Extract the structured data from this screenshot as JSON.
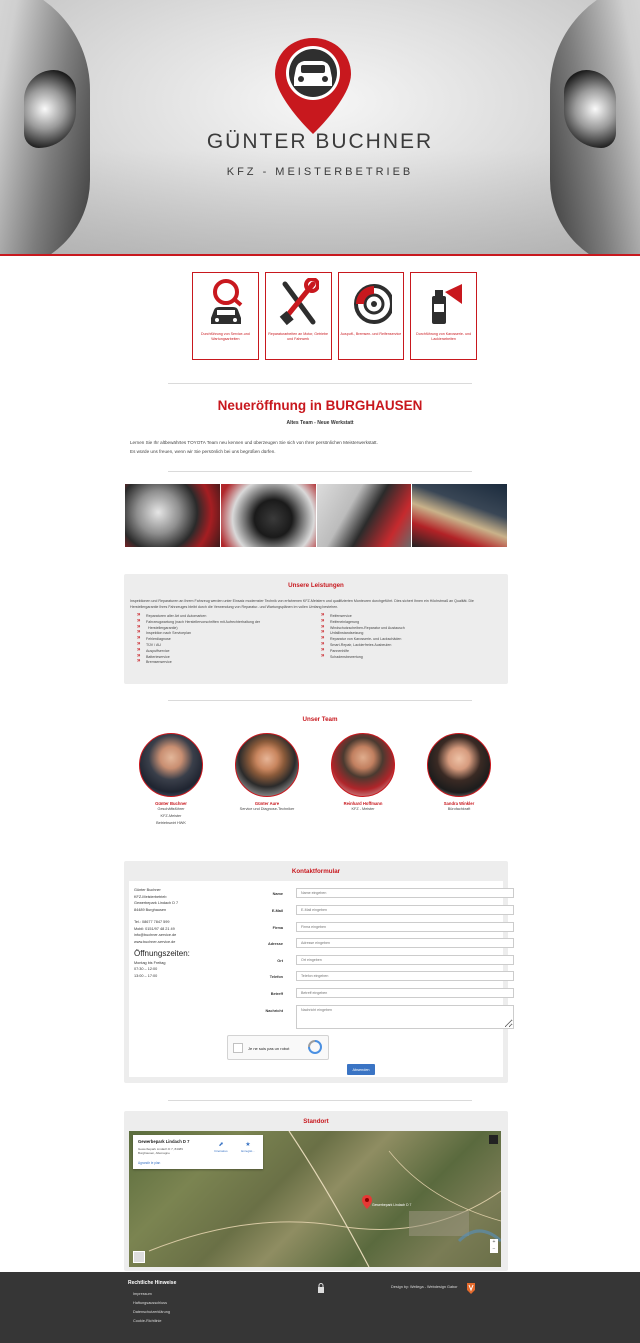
{
  "brand": {
    "name": "GÜNTER BUCHNER",
    "tagline": "KFZ - MEISTERBETRIEB",
    "accent": "#c8181e"
  },
  "services": [
    {
      "icon": "car-search-icon",
      "label": "Durchführung von Service-und Wartungsarbeiten"
    },
    {
      "icon": "tools-icon",
      "label": "Reparaturarbeiten an Motor, Getriebe und Fahrwerk"
    },
    {
      "icon": "brake-disc-icon",
      "label": "Auspuff-, Bremsen- und Reifenservice"
    },
    {
      "icon": "spray-can-icon",
      "label": "Durchführung von Karosserie- und Lackierarbeiten"
    }
  ],
  "news": {
    "title": "Neueröffnung in BURGHAUSEN",
    "subtitle": "Altes Team - Neue Werkstatt",
    "line1": "Lernen Sie Ihr altbewährtes TOYOTA Team neu kennen und überzeugen Sie sich von Ihrer persönlichen Meisterwerkstatt.",
    "line2": "Es würde uns freuen, wenn wir Sie persönlich bei uns begrüßen dürfen."
  },
  "leistungen": {
    "title": "Unsere Leistungen",
    "intro": "Inspektionen und Reparaturen an Ihrem Fahrzeug werden unter Einsatz modernster Technik von erfahrenen KFZ-Meistern und qualifizierten Monteuren durchgeführt. Dies sichert Ihnen ein Höchstmaß an Qualität. Die Herstellergarantie Ihres Fahrzeuges bleibt durch die Verwendung von Reparatur- und Wartungsplänen im vollen Umfang bestehen.",
    "left": [
      "Reparaturen aller Art und Automarken",
      "Fahrzeugwartung (nach Herstellervorschriften mit Aufrechterhaltung der",
      "Herstellergarantie)",
      "Inspektion nach Serviceplan",
      "Fehlerdiagnose",
      "TÜV / AU",
      "Auspuffservice",
      "Batterieservice",
      "Bremsenservice"
    ],
    "right": [
      "Reifenservice",
      "Reifeneinlagerung",
      "Windschutzscheiben-Reparatur und Austausch",
      "Unfallinstandsetzung",
      "Reparatur von Karosserie- und Lackschäden",
      "Smart-Repair, Lackierfreies Ausbeulen",
      "Pannenhilfe",
      "Schadensbewertung"
    ]
  },
  "team": {
    "title": "Unser Team",
    "members": [
      {
        "name": "Günter Buchner",
        "roles": [
          "Geschäftsführer",
          "KFZ-Meister",
          "Betriebswirt HWK"
        ]
      },
      {
        "name": "Günter Aure",
        "roles": [
          "Service und Diagnose-Techniker"
        ]
      },
      {
        "name": "Reinhard Hoffmann",
        "roles": [
          "KFZ - Meister"
        ]
      },
      {
        "name": "Sandra Winkler",
        "roles": [
          "Bürofachkraft"
        ]
      }
    ]
  },
  "contact": {
    "title": "Kontaktformular",
    "address": [
      "Günter Buchner",
      "KFZ-Meisterbetrieb",
      "Gewerbepark Lindach D 7",
      "84489 Burghausen"
    ],
    "phones": [
      "Tel.: 08677 7847 599",
      "Mobil: 0151/97 48 21 49",
      "info@buchner-service.de",
      "www.buchner-service.de"
    ],
    "hours_title": "Öffnungszeiten:",
    "hours": [
      "Montag bis Freitag",
      "07:30 – 12:00",
      "13:00 – 17:00"
    ],
    "fields": [
      {
        "label": "Name",
        "placeholder": "Name eingeben"
      },
      {
        "label": "E-Mail",
        "placeholder": "E-Mail eingeben"
      },
      {
        "label": "Firma",
        "placeholder": "Firma eingeben"
      },
      {
        "label": "Adresse",
        "placeholder": "Adresse eingeben"
      },
      {
        "label": "Ort",
        "placeholder": "Ort eingeben"
      },
      {
        "label": "Telefon",
        "placeholder": "Telefon eingeben"
      },
      {
        "label": "Betreff",
        "placeholder": "Betreff eingeben"
      },
      {
        "label": "Nachricht",
        "placeholder": "Nachricht eingeben"
      }
    ],
    "captcha": "Je ne suis pas un robot",
    "submit": "Absenden"
  },
  "standort": {
    "title": "Standort",
    "card_title": "Gewerbepark Lindach D 7",
    "card_address": "Gewerbepark Lindach D 7, 84489 Burghausen, Allemagne",
    "card_link": "Agrandir le plan",
    "route": "Itinéraires",
    "save": "Enregist...",
    "pin_label": "Gewerbepark Lindach D 7"
  },
  "footer": {
    "title": "Rechtliche Hinweise",
    "links": [
      "Impressum",
      "Haftungsausschluss",
      "Datenschutzerklärung",
      "Cookie-Richtlinie"
    ],
    "design": "Design by: Weilega - Webdesign Gabor"
  }
}
